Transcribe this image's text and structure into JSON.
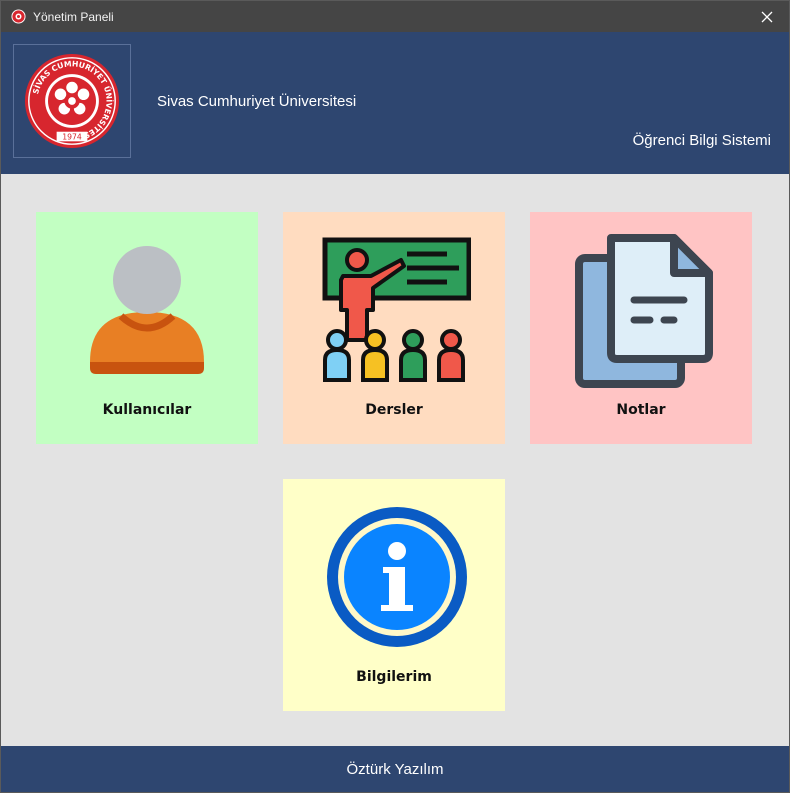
{
  "window": {
    "title": "Yönetim Paneli"
  },
  "header": {
    "university": "Sivas Cumhuriyet Üniversitesi",
    "system": "Öğrenci Bilgi Sistemi",
    "logo": {
      "ring_text": "SİVAS CUMHURİYET ÜNİVERSİTESİ",
      "year": "1974"
    }
  },
  "tiles": [
    {
      "label": "Kullanıcılar",
      "icon": "user-icon",
      "color": "#c2ffc2"
    },
    {
      "label": "Dersler",
      "icon": "teacher-class-icon",
      "color": "#ffdcc0"
    },
    {
      "label": "Notlar",
      "icon": "document-icon",
      "color": "#ffc4c4"
    },
    {
      "label": "Bilgilerim",
      "icon": "info-icon",
      "color": "#ffffc8"
    }
  ],
  "footer": {
    "text": "Öztürk Yazılım"
  },
  "colors": {
    "header_bg": "#2e4670",
    "body_bg": "#e3e3e3",
    "titlebar_bg": "#454545"
  }
}
